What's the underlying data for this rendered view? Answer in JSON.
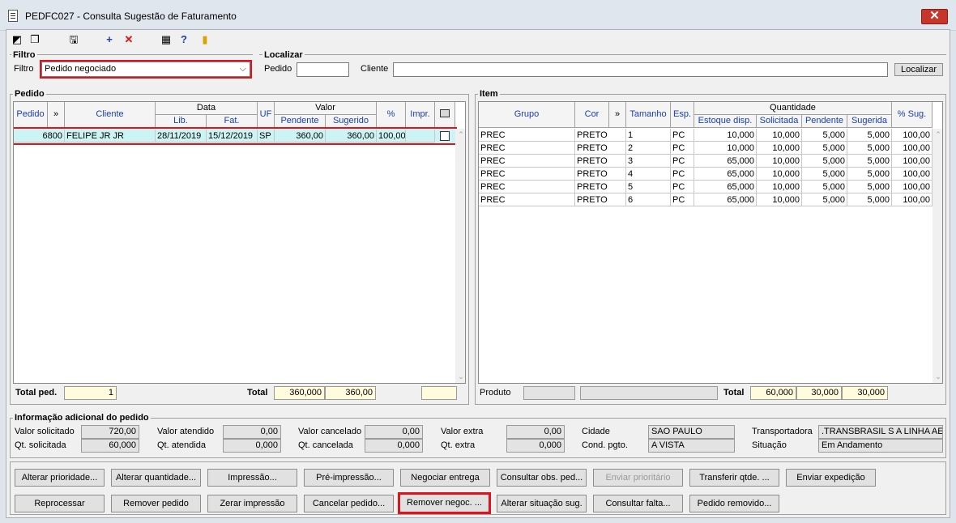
{
  "window": {
    "title": "PEDFC027 - Consulta Sugestão de Faturamento",
    "close": "✕"
  },
  "filtro": {
    "legend": "Filtro",
    "label": "Filtro",
    "value": "Pedido negociado"
  },
  "localizar": {
    "legend": "Localizar",
    "pedido_label": "Pedido",
    "cliente_label": "Cliente",
    "pedido_value": "",
    "cliente_value": "",
    "button": "Localizar"
  },
  "pedido": {
    "legend": "Pedido",
    "headers": {
      "pedido": "Pedido",
      "more": "»",
      "cliente": "Cliente",
      "data": "Data",
      "lib": "Lib.",
      "fat": "Fat.",
      "uf": "UF",
      "valor": "Valor",
      "pendente": "Pendente",
      "sugerido": "Sugerido",
      "pct": "%",
      "impr": "Impr."
    },
    "rows": [
      {
        "pedido": "6800",
        "cliente": "FELIPE JR JR",
        "lib": "28/11/2019",
        "fat": "15/12/2019",
        "uf": "SP",
        "pendente": "360,00",
        "sugerido": "360,00",
        "pct": "100,00",
        "impr": ""
      }
    ],
    "total_ped_label": "Total ped.",
    "total_ped": "1",
    "total_label": "Total",
    "total_pendente": "360,000",
    "total_sugerido": "360,00",
    "total_extra": ""
  },
  "item": {
    "legend": "Item",
    "headers": {
      "grupo": "Grupo",
      "cor": "Cor",
      "more": "»",
      "tamanho": "Tamanho",
      "esp": "Esp.",
      "quantidade": "Quantidade",
      "estoque": "Estoque disp.",
      "solicitada": "Solicitada",
      "pendente": "Pendente",
      "sugerida": "Sugerida",
      "pct_sug": "% Sug."
    },
    "rows": [
      {
        "grupo": "PREC",
        "cor": "PRETO",
        "tamanho": "1",
        "esp": "PC",
        "estoque": "10,000",
        "solicitada": "10,000",
        "pendente": "5,000",
        "sugerida": "5,000",
        "pct": "100,00"
      },
      {
        "grupo": "PREC",
        "cor": "PRETO",
        "tamanho": "2",
        "esp": "PC",
        "estoque": "10,000",
        "solicitada": "10,000",
        "pendente": "5,000",
        "sugerida": "5,000",
        "pct": "100,00"
      },
      {
        "grupo": "PREC",
        "cor": "PRETO",
        "tamanho": "3",
        "esp": "PC",
        "estoque": "65,000",
        "solicitada": "10,000",
        "pendente": "5,000",
        "sugerida": "5,000",
        "pct": "100,00"
      },
      {
        "grupo": "PREC",
        "cor": "PRETO",
        "tamanho": "4",
        "esp": "PC",
        "estoque": "65,000",
        "solicitada": "10,000",
        "pendente": "5,000",
        "sugerida": "5,000",
        "pct": "100,00"
      },
      {
        "grupo": "PREC",
        "cor": "PRETO",
        "tamanho": "5",
        "esp": "PC",
        "estoque": "65,000",
        "solicitada": "10,000",
        "pendente": "5,000",
        "sugerida": "5,000",
        "pct": "100,00"
      },
      {
        "grupo": "PREC",
        "cor": "PRETO",
        "tamanho": "6",
        "esp": "PC",
        "estoque": "65,000",
        "solicitada": "10,000",
        "pendente": "5,000",
        "sugerida": "5,000",
        "pct": "100,00"
      }
    ],
    "produto_label": "Produto",
    "total_label": "Total",
    "total_solicitada": "60,000",
    "total_pendente": "30,000",
    "total_sugerida": "30,000"
  },
  "info": {
    "legend": "Informação adicional do pedido",
    "valor_solicitado_label": "Valor solicitado",
    "valor_solicitado": "720,00",
    "qt_solicitada_label": "Qt. solicitada",
    "qt_solicitada": "60,000",
    "valor_atendido_label": "Valor atendido",
    "valor_atendido": "0,00",
    "qt_atendida_label": "Qt. atendida",
    "qt_atendida": "0,000",
    "valor_cancelado_label": "Valor cancelado",
    "valor_cancelado": "0,00",
    "qt_cancelada_label": "Qt. cancelada",
    "qt_cancelada": "0,000",
    "valor_extra_label": "Valor extra",
    "valor_extra": "0,00",
    "qt_extra_label": "Qt. extra",
    "qt_extra": "0,000",
    "cidade_label": "Cidade",
    "cidade": "SAO PAULO",
    "cond_label": "Cond. pgto.",
    "cond": "A VISTA",
    "transp_label": "Transportadora",
    "transp": ".TRANSBRASIL S A LINHA AERI",
    "situacao_label": "Situação",
    "situacao": "Em Andamento"
  },
  "buttons": {
    "alterar_prioridade": "Alterar prioridade...",
    "alterar_quantidade": "Alterar quantidade...",
    "impressao": "Impressão...",
    "pre_impressao": "Pré-impressão...",
    "negociar_entrega": "Negociar entrega",
    "consultar_obs": "Consultar obs. ped...",
    "enviar_prioritario": "Enviar prioritário",
    "transferir_qtde": "Transferir qtde. ...",
    "enviar_expedicao": "Enviar expedição",
    "reprocessar": "Reprocessar",
    "remover_pedido": "Remover pedido",
    "zerar_impressao": "Zerar impressão",
    "cancelar_pedido": "Cancelar pedido...",
    "remover_negoc": "Remover negoc. ...",
    "alterar_situacao": "Alterar situação sug.",
    "consultar_falta": "Consultar falta...",
    "pedido_removido": "Pedido removido..."
  }
}
